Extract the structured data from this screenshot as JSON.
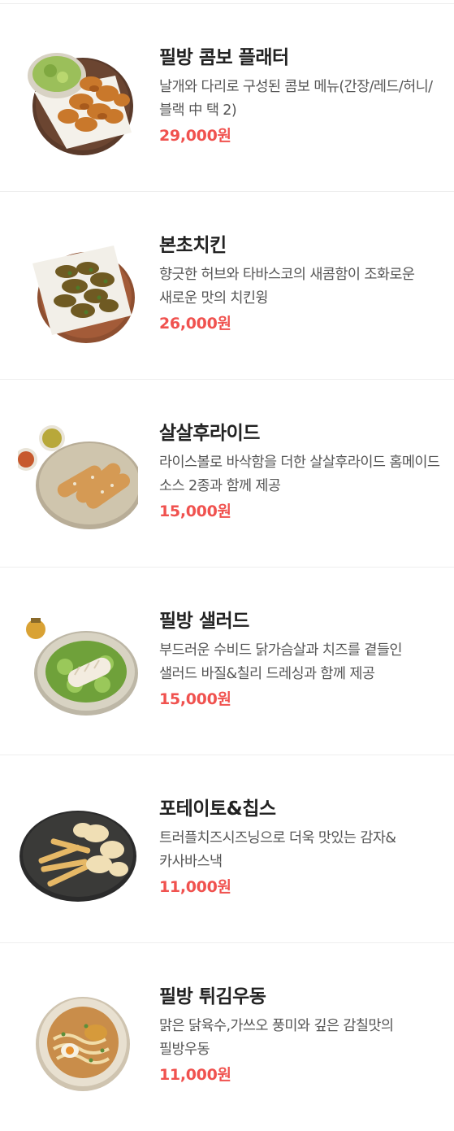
{
  "accent_price_color": "#f0524f",
  "menu": [
    {
      "name": "필방 콤보 플래터",
      "description": "날개와 다리로 구성된 콤보 메뉴(간장/레드/허니/블랙 中 택 2)",
      "price": "29,000원",
      "image": "combo-platter-photo"
    },
    {
      "name": "본초치킨",
      "description": "향긋한 허브와 타바스코의 새콤함이 조화로운 새로운 맛의 치킨윙",
      "price": "26,000원",
      "image": "herb-chicken-photo"
    },
    {
      "name": "살살후라이드",
      "description": "라이스볼로 바삭함을 더한 살살후라이드 홈메이드 소스 2종과 함께 제공",
      "price": "15,000원",
      "image": "fried-tenders-photo"
    },
    {
      "name": "필방 샐러드",
      "description": "부드러운 수비드 닭가슴살과 치즈를 곁들인 샐러드 바질&칠리 드레싱과 함께 제공",
      "price": "15,000원",
      "image": "salad-photo"
    },
    {
      "name": "포테이토&칩스",
      "description": "트러플치즈시즈닝으로 더욱 맛있는 감자&카사바스낵",
      "price": "11,000원",
      "image": "potato-chips-photo"
    },
    {
      "name": "필방 튀김우동",
      "description": "맑은 닭육수,가쓰오 풍미와 깊은 감칠맛의 필방우동",
      "price": "11,000원",
      "image": "udon-photo"
    }
  ]
}
